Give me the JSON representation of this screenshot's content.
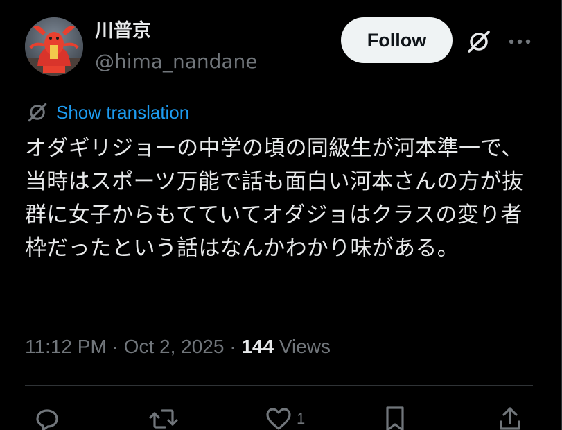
{
  "author": {
    "display_name": "川普京",
    "handle": "@hima_nandane"
  },
  "header": {
    "follow_label": "Follow"
  },
  "post": {
    "translate_label": "Show translation",
    "text": "オダギリジョーの中学の頃の同級生が河本準一で、当時はスポーツ万能で話も面白い河本さんの方が抜群に女子からもてていてオダジョはクラスの変り者枠だったという話はなんかわかり味がある。",
    "time": "11:12 PM",
    "separator": "·",
    "date": "Oct 2, 2025",
    "views_count": "144",
    "views_label": "Views"
  },
  "actions": {
    "like_count": "1"
  },
  "colors": {
    "background": "#000000",
    "text_primary": "#e7e9ea",
    "text_secondary": "#71767b",
    "link": "#1d9bf0",
    "follow_bg": "#eff3f4",
    "divider": "#2f3336"
  },
  "icons": {
    "grok": "grok-icon",
    "more": "more-icon",
    "translate": "translate-icon",
    "reply": "reply-icon",
    "repost": "repost-icon",
    "like": "like-icon",
    "bookmark": "bookmark-icon",
    "share": "share-icon"
  }
}
